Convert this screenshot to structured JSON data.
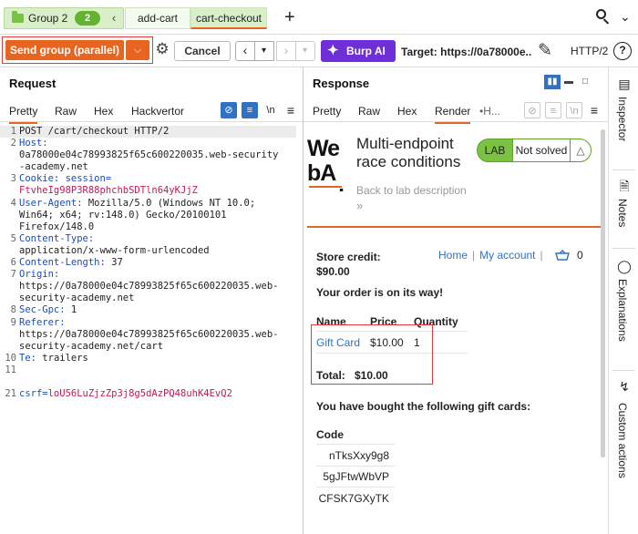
{
  "tabs": {
    "group_name": "Group 2",
    "group_count": "2",
    "items": [
      {
        "label": "add-cart"
      },
      {
        "label": "cart-checkout"
      }
    ],
    "add_label": "+"
  },
  "toolbar": {
    "send_label": "Send group (parallel)",
    "cancel_label": "Cancel",
    "burp_ai_label": "Burp AI",
    "target_label": "Target: https://0a78000e...",
    "http_version": "HTTP/2",
    "help_label": "?"
  },
  "request": {
    "title": "Request",
    "tabs": [
      "Pretty",
      "Raw",
      "Hex",
      "Hackvertor"
    ],
    "newline_label": "\\n",
    "lines": [
      {
        "n": "1",
        "key": "",
        "val": "",
        "text": "POST /cart/checkout HTTP/2"
      },
      {
        "n": "2",
        "key": "Host:",
        "val": "",
        "text": ""
      },
      {
        "n": "",
        "key": "",
        "val": "",
        "text": "0a78000e04c78993825f65c600220035.web-security"
      },
      {
        "n": "",
        "key": "",
        "val": "",
        "text": "-academy.net"
      },
      {
        "n": "3",
        "key": "Cookie: session=",
        "val": "",
        "text": ""
      },
      {
        "n": "",
        "key": "",
        "val": "FtvheIg98P3R88phchbSDTln64yKJjZ",
        "text": ""
      },
      {
        "n": "4",
        "key": "User-Agent: ",
        "val": "",
        "text": "Mozilla/5.0 (Windows NT 10.0;"
      },
      {
        "n": "",
        "key": "",
        "val": "",
        "text": "Win64; x64; rv:148.0) Gecko/20100101"
      },
      {
        "n": "",
        "key": "",
        "val": "",
        "text": "Firefox/148.0"
      },
      {
        "n": "5",
        "key": "Content-Type:",
        "val": "",
        "text": ""
      },
      {
        "n": "",
        "key": "",
        "val": "",
        "text": "application/x-www-form-urlencoded"
      },
      {
        "n": "6",
        "key": "Content-Length: ",
        "val": "",
        "text": "37"
      },
      {
        "n": "7",
        "key": "Origin:",
        "val": "",
        "text": ""
      },
      {
        "n": "",
        "key": "",
        "val": "",
        "text": "https://0a78000e04c78993825f65c600220035.web-"
      },
      {
        "n": "",
        "key": "",
        "val": "",
        "text": "security-academy.net"
      },
      {
        "n": "8",
        "key": "Sec-Gpc: ",
        "val": "",
        "text": "1"
      },
      {
        "n": "9",
        "key": "Referer:",
        "val": "",
        "text": ""
      },
      {
        "n": "",
        "key": "",
        "val": "",
        "text": "https://0a78000e04c78993825f65c600220035.web-"
      },
      {
        "n": "",
        "key": "",
        "val": "",
        "text": "security-academy.net/cart"
      },
      {
        "n": "10",
        "key": "Te: ",
        "val": "",
        "text": "trailers"
      },
      {
        "n": "11",
        "key": "",
        "val": "",
        "text": ""
      },
      {
        "n": "",
        "key": "",
        "val": "",
        "text": ""
      },
      {
        "n": "21",
        "key": "csrf=",
        "val": "loU56LuZjzZp3j8g5dAzPQ48uhK4EvQ2",
        "text": ""
      }
    ]
  },
  "response": {
    "title": "Response",
    "tabs": [
      "Pretty",
      "Raw",
      "Hex",
      "Render",
      "•H..."
    ],
    "newline_label": "\\n",
    "render": {
      "logo_text": "WebAcademy",
      "lab_title": "Multi-endpoint race conditions",
      "lab_badge": "LAB",
      "lab_status": "Not solved",
      "back_link": "Back to lab description",
      "back_chevron": "»",
      "store_credit_label": "Store credit:",
      "store_credit_value": "$90.00",
      "nav_home": "Home",
      "nav_sep": "|",
      "nav_account": "My account",
      "cart_count": "0",
      "order_message": "Your order is on its way!",
      "table_headers": [
        "Name",
        "Price",
        "Quantity"
      ],
      "item": {
        "name": "Gift Card",
        "price": "$10.00",
        "quantity": "1"
      },
      "total_label": "Total:",
      "total_value": "$10.00",
      "bought_message": "You have bought the following gift cards:",
      "code_header": "Code",
      "codes": [
        "nTksXxy9g8",
        "5gJFtwWbVP",
        "CFSK7GXyTK"
      ]
    }
  },
  "side_rail": [
    "Inspector",
    "Notes",
    "Explanations",
    "Custom actions"
  ],
  "colors": {
    "accent": "#e8651f",
    "group": "#7cc242",
    "burp_ai": "#6f2fd8",
    "link": "#2f72c4",
    "highlight": "#e83a3a"
  }
}
